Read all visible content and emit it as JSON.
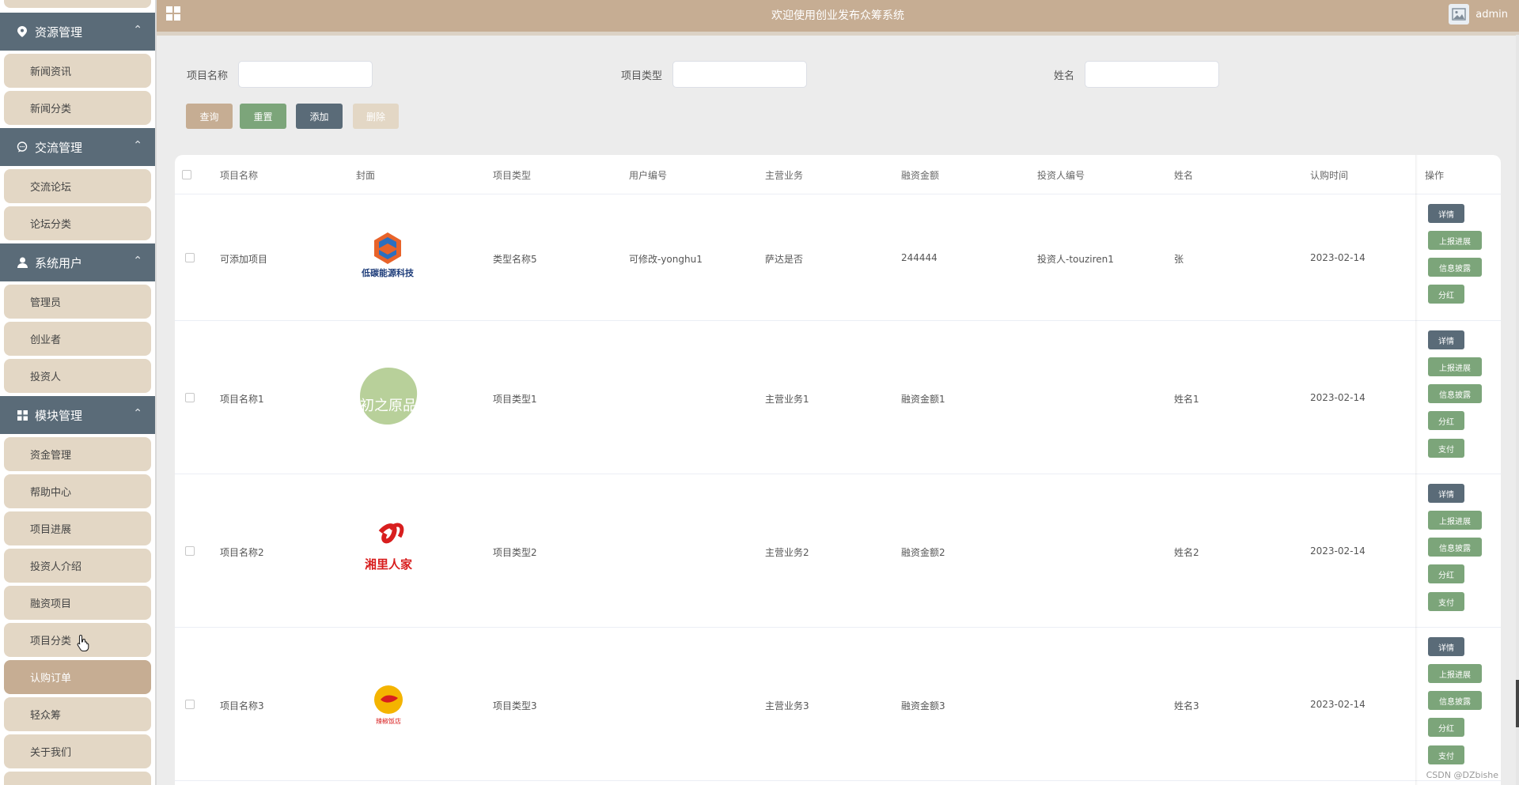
{
  "header": {
    "title": "欢迎使用创业发布众筹系统",
    "username": "admin"
  },
  "sidebar": {
    "groups": [
      {
        "label": "资源管理",
        "icon": "location-pin-icon",
        "items": [
          "新闻资讯",
          "新闻分类"
        ]
      },
      {
        "label": "交流管理",
        "icon": "chat-icon",
        "items": [
          "交流论坛",
          "论坛分类"
        ]
      },
      {
        "label": "系统用户",
        "icon": "user-icon",
        "items": [
          "管理员",
          "创业者",
          "投资人"
        ]
      },
      {
        "label": "模块管理",
        "icon": "grid-icon",
        "items": [
          "资金管理",
          "帮助中心",
          "项目进展",
          "投资人介绍",
          "融资项目",
          "项目分类",
          "认购订单",
          "轻众筹",
          "关于我们"
        ]
      }
    ],
    "active_item": "认购订单"
  },
  "search": {
    "fields": [
      {
        "label": "项目名称",
        "value": ""
      },
      {
        "label": "项目类型",
        "value": ""
      },
      {
        "label": "姓名",
        "value": ""
      }
    ],
    "buttons": {
      "query": "查询",
      "reset": "重置",
      "add": "添加",
      "delete": "删除"
    }
  },
  "colors": {
    "accent": "#c6ad93",
    "sidebar_group": "#5a6b78",
    "sidebar_item": "#e3d7c5",
    "green": "#7ca57a",
    "dark": "#5a6b78"
  },
  "table": {
    "columns": [
      "项目名称",
      "封面",
      "项目类型",
      "用户编号",
      "主营业务",
      "融资金额",
      "投资人编号",
      "姓名",
      "认购时间",
      "操作"
    ],
    "rows": [
      {
        "name": "可添加项目",
        "cover_text": "低碳能源科技",
        "type": "类型名称5",
        "user_no": "可修改-yonghu1",
        "business": "萨达是否",
        "amount": "244444",
        "investor_no": "投资人-touziren1",
        "person": "张",
        "time": "2023-02-14",
        "ops": [
          "详情",
          "上报进展",
          "信息披露",
          "分红"
        ]
      },
      {
        "name": "项目名称1",
        "cover_text": "初之原品",
        "type": "项目类型1",
        "user_no": "",
        "business": "主营业务1",
        "amount": "融资金额1",
        "investor_no": "",
        "person": "姓名1",
        "time": "2023-02-14",
        "ops": [
          "详情",
          "上报进展",
          "信息披露",
          "分红",
          "支付"
        ]
      },
      {
        "name": "项目名称2",
        "cover_text": "湘里人家",
        "type": "项目类型2",
        "user_no": "",
        "business": "主营业务2",
        "amount": "融资金额2",
        "investor_no": "",
        "person": "姓名2",
        "time": "2023-02-14",
        "ops": [
          "详情",
          "上报进展",
          "信息披露",
          "分红",
          "支付"
        ]
      },
      {
        "name": "项目名称3",
        "cover_text": "辣椒饭店",
        "type": "项目类型3",
        "user_no": "",
        "business": "主营业务3",
        "amount": "融资金额3",
        "investor_no": "",
        "person": "姓名3",
        "time": "2023-02-14",
        "ops": [
          "详情",
          "上报进展",
          "信息披露",
          "分红",
          "支付"
        ]
      }
    ]
  },
  "watermark": "CSDN @DZbishe"
}
